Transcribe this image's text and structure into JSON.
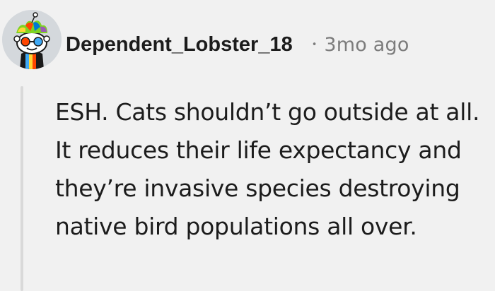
{
  "comment": {
    "author": "Dependent_Lobster_18",
    "separator": "•",
    "timestamp": "3mo ago",
    "body": "ESH. Cats shouldn’t go outside at all. It reduces their life expectancy and they’re invasive species destroying native bird populations all over.",
    "avatar_icon": "snoo-avatar-icon"
  },
  "colors": {
    "background": "#f1f1f1",
    "text": "#1c1c1c",
    "meta": "#7c7c7c",
    "thread_line": "#d9d9d9"
  }
}
